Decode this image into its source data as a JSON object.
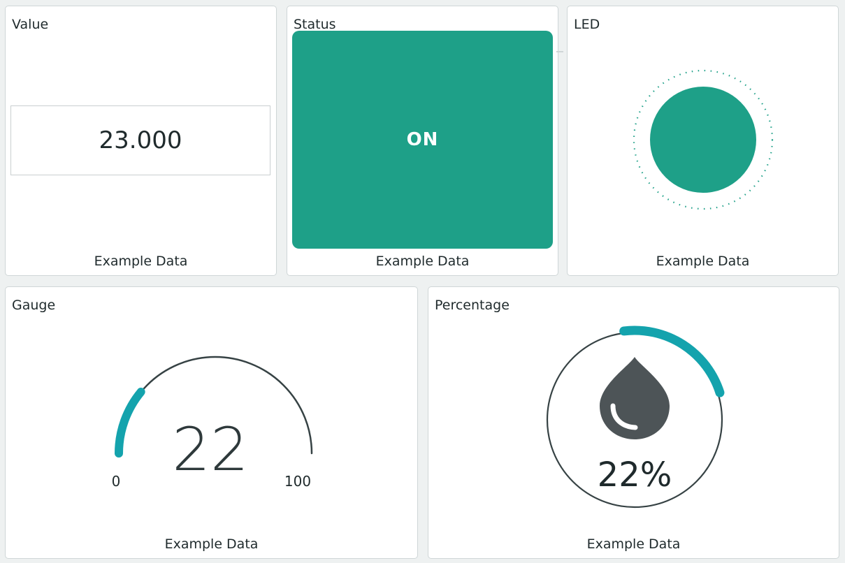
{
  "colors": {
    "accent": "#1ea088",
    "gauge_fill": "#14a3ad",
    "gauge_track": "#364244",
    "drop": "#4d5457"
  },
  "value_card": {
    "title": "Value",
    "value": "23.000",
    "footer": "Example Data"
  },
  "status_card": {
    "title": "Status",
    "state_label": "ON",
    "footer": "Example Data"
  },
  "led_card": {
    "title": "LED",
    "state": "on",
    "footer": "Example Data"
  },
  "gauge_card": {
    "title": "Gauge",
    "value": "22",
    "min": "0",
    "max": "100",
    "footer": "Example Data"
  },
  "percentage_card": {
    "title": "Percentage",
    "value_label": "22%",
    "percent": 22,
    "icon": "water-drop-icon",
    "footer": "Example Data"
  }
}
